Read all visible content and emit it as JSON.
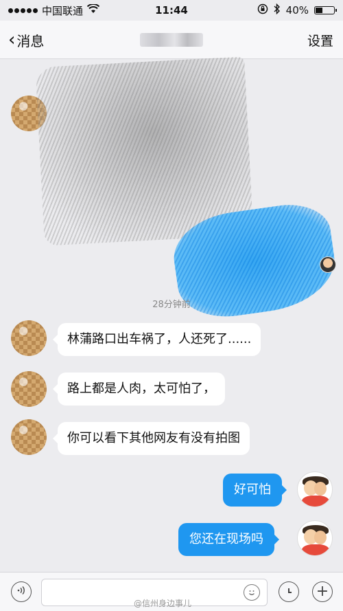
{
  "status_bar": {
    "carrier": "中国联通",
    "time": "11:44",
    "battery": "40%",
    "battery_level": 0.4
  },
  "nav": {
    "back_label": "消息",
    "settings_label": "设置"
  },
  "chat": {
    "time_label": "28分钟前",
    "incoming": [
      {
        "text": "林蒲路口出车祸了，人还死了......"
      },
      {
        "text": "路上都是人肉，太可怕了，"
      },
      {
        "text": "你可以看下其他网友有没有拍图"
      }
    ],
    "outgoing": [
      {
        "text": "好可怕"
      },
      {
        "text": "您还在现场吗"
      }
    ]
  },
  "input_bar": {
    "watermark": "@信州身边事儿"
  },
  "colors": {
    "bubble_outgoing": "#1f97f0",
    "background": "#ececef"
  }
}
